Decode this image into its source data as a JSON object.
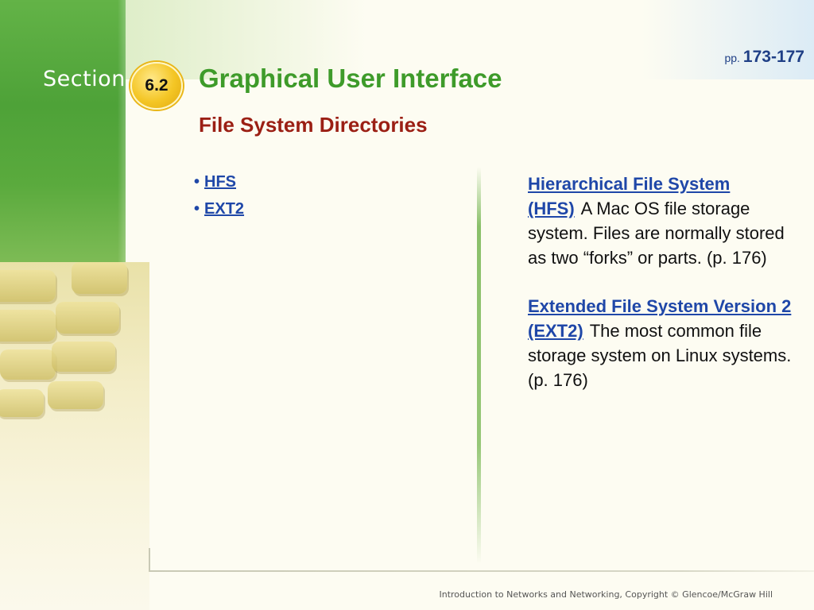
{
  "header": {
    "section_label": "Section",
    "section_number": "6.2",
    "page_prefix": "pp.",
    "page_range": "173-177",
    "title": "Graphical User Interface",
    "subtitle": "File System Directories"
  },
  "bullets": [
    {
      "label": "HFS"
    },
    {
      "label": "EXT2"
    }
  ],
  "definitions": [
    {
      "term": "Hierarchical File System (HFS)",
      "text": "A Mac OS file storage system. Files are normally stored as two “forks” or parts. (p. 176)"
    },
    {
      "term": "Extended File System Version 2 (EXT2)",
      "text": "The most common file storage system on Linux systems. (p. 176)"
    }
  ],
  "footer": {
    "copyright": "Introduction to Networks and Networking, Copyright © Glencoe/McGraw Hill"
  },
  "colors": {
    "title": "#3e9b2a",
    "subtitle": "#9b1f14",
    "link": "#1f47a8",
    "band": "#4ea238",
    "badge": "#f4c625"
  }
}
